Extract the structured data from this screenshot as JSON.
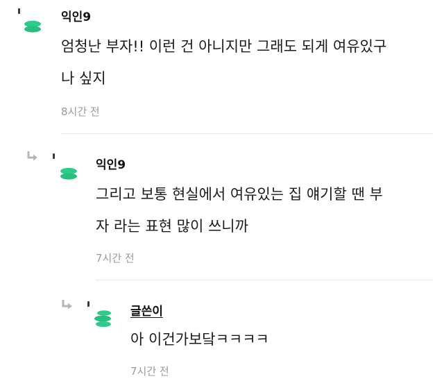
{
  "colors": {
    "accent": "#2ecc8a",
    "time_text": "#9a9a9a",
    "divider": "#e8e8e8"
  },
  "comments": [
    {
      "author": "익인9",
      "body_lines": [
        "엄청난 부자!! 이런 건 아니지만 그래도 되게 여유있구",
        "나 싶지"
      ],
      "time": "8시간 전",
      "avatar_icon": "leaf-avatar-icon"
    },
    {
      "author": "익인9",
      "body_lines": [
        "그리고 보통 현실에서 여유있는 집 얘기할 땐 부",
        "자 라는 표현 많이 쓰니까"
      ],
      "time": "7시간 전",
      "avatar_icon": "leaf-avatar-icon",
      "reply_icon": "reply-arrow-icon"
    },
    {
      "author": "글쓴이",
      "body_lines": [
        "아 이건가보닼ㅋㅋㅋㅋ"
      ],
      "time": "7시간 전",
      "avatar_icon": "leaf-avatar-icon",
      "reply_icon": "reply-arrow-icon"
    }
  ]
}
